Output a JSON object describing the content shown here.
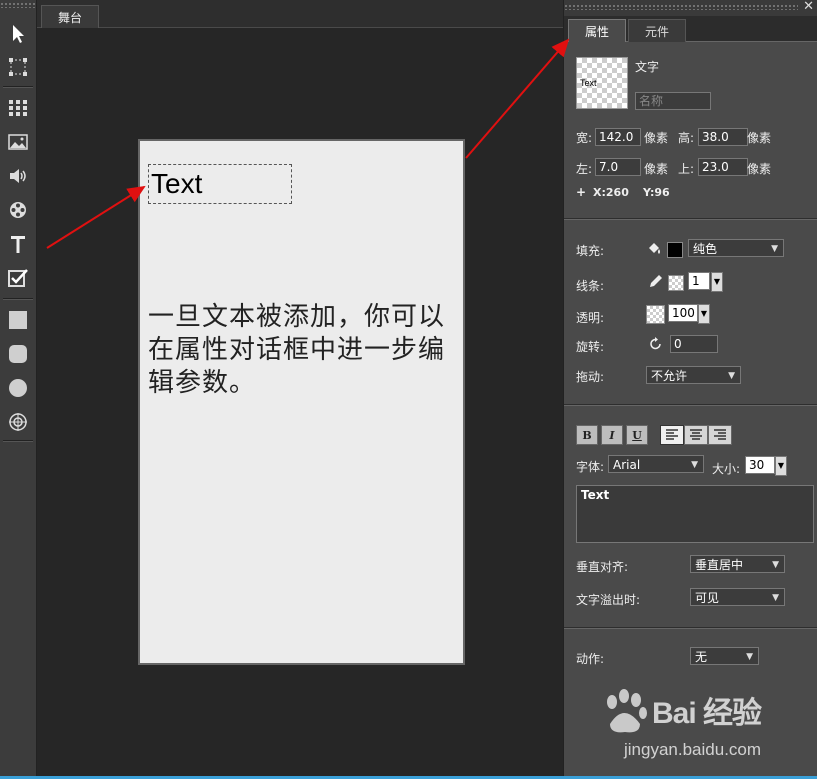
{
  "stage": {
    "tab_label": "舞台",
    "text_object_label": "Text",
    "canvas_paragraph": "一旦文本被添加，你可以在属性对话框中进一步编辑参数。"
  },
  "toolbar": {
    "tools": [
      {
        "name": "select-arrow-icon"
      },
      {
        "name": "transform-icon"
      },
      {
        "name": "grid-icon"
      },
      {
        "name": "image-icon"
      },
      {
        "name": "sound-icon"
      },
      {
        "name": "video-reel-icon"
      },
      {
        "name": "text-tool-icon"
      },
      {
        "name": "checkbox-icon"
      },
      {
        "name": "rectangle-icon"
      },
      {
        "name": "rounded-rectangle-icon"
      },
      {
        "name": "circle-icon"
      },
      {
        "name": "target-icon"
      }
    ]
  },
  "panel": {
    "close_glyph": "✕",
    "tabs": [
      {
        "label": "属性"
      },
      {
        "label": "元件"
      }
    ],
    "thumbnail_label": "Text",
    "object_type": "文字",
    "name_placeholder": "名称",
    "width_label": "宽:",
    "width_value": "142.0",
    "height_label": "高:",
    "height_value": "38.0",
    "unit": "像素",
    "left_label": "左:",
    "left_value": "7.0",
    "top_label": "上:",
    "top_value": "23.0",
    "cursor_plus": "+",
    "cursor_x": "X:260",
    "cursor_y": "Y:96",
    "fill_label": "填充:",
    "fill_mode": "纯色",
    "fill_color": "#000000",
    "stroke_label": "线条:",
    "stroke_width": "1",
    "opacity_label": "透明:",
    "opacity_value": "100",
    "rotate_label": "旋转:",
    "rotate_value": "0",
    "drag_label": "拖动:",
    "drag_value": "不允许",
    "format_buttons": [
      "B",
      "I",
      "U"
    ],
    "font_label": "字体:",
    "font_value": "Arial",
    "size_label": "大小:",
    "size_value": "30",
    "text_content": "Text",
    "valign_label": "垂直对齐:",
    "valign_value": "垂直居中",
    "overflow_label": "文字溢出时:",
    "overflow_value": "可见",
    "action_label": "动作:",
    "action_value": "无"
  },
  "watermark": {
    "brand": "Bai  经验",
    "url": "jingyan.baidu.com"
  },
  "colors": {
    "arrow": "#e01010",
    "accent_line": "#3aa0d8"
  }
}
